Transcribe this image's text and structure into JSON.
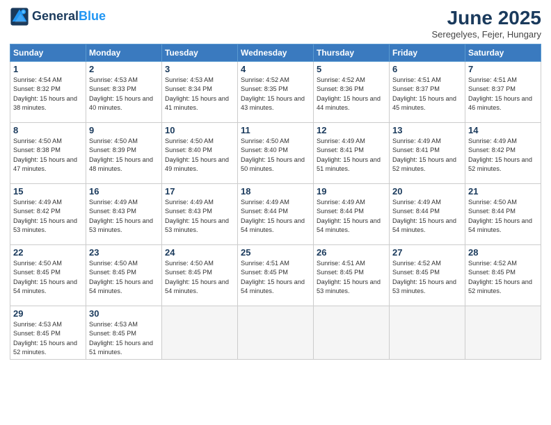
{
  "header": {
    "logo_line1": "General",
    "logo_line2": "Blue",
    "month_year": "June 2025",
    "location": "Seregelyes, Fejer, Hungary"
  },
  "weekdays": [
    "Sunday",
    "Monday",
    "Tuesday",
    "Wednesday",
    "Thursday",
    "Friday",
    "Saturday"
  ],
  "weeks": [
    [
      {
        "day": 1,
        "sunrise": "4:54 AM",
        "sunset": "8:32 PM",
        "daylight": "15 hours and 38 minutes."
      },
      {
        "day": 2,
        "sunrise": "4:53 AM",
        "sunset": "8:33 PM",
        "daylight": "15 hours and 40 minutes."
      },
      {
        "day": 3,
        "sunrise": "4:53 AM",
        "sunset": "8:34 PM",
        "daylight": "15 hours and 41 minutes."
      },
      {
        "day": 4,
        "sunrise": "4:52 AM",
        "sunset": "8:35 PM",
        "daylight": "15 hours and 43 minutes."
      },
      {
        "day": 5,
        "sunrise": "4:52 AM",
        "sunset": "8:36 PM",
        "daylight": "15 hours and 44 minutes."
      },
      {
        "day": 6,
        "sunrise": "4:51 AM",
        "sunset": "8:37 PM",
        "daylight": "15 hours and 45 minutes."
      },
      {
        "day": 7,
        "sunrise": "4:51 AM",
        "sunset": "8:37 PM",
        "daylight": "15 hours and 46 minutes."
      }
    ],
    [
      {
        "day": 8,
        "sunrise": "4:50 AM",
        "sunset": "8:38 PM",
        "daylight": "15 hours and 47 minutes."
      },
      {
        "day": 9,
        "sunrise": "4:50 AM",
        "sunset": "8:39 PM",
        "daylight": "15 hours and 48 minutes."
      },
      {
        "day": 10,
        "sunrise": "4:50 AM",
        "sunset": "8:40 PM",
        "daylight": "15 hours and 49 minutes."
      },
      {
        "day": 11,
        "sunrise": "4:50 AM",
        "sunset": "8:40 PM",
        "daylight": "15 hours and 50 minutes."
      },
      {
        "day": 12,
        "sunrise": "4:49 AM",
        "sunset": "8:41 PM",
        "daylight": "15 hours and 51 minutes."
      },
      {
        "day": 13,
        "sunrise": "4:49 AM",
        "sunset": "8:41 PM",
        "daylight": "15 hours and 52 minutes."
      },
      {
        "day": 14,
        "sunrise": "4:49 AM",
        "sunset": "8:42 PM",
        "daylight": "15 hours and 52 minutes."
      }
    ],
    [
      {
        "day": 15,
        "sunrise": "4:49 AM",
        "sunset": "8:42 PM",
        "daylight": "15 hours and 53 minutes."
      },
      {
        "day": 16,
        "sunrise": "4:49 AM",
        "sunset": "8:43 PM",
        "daylight": "15 hours and 53 minutes."
      },
      {
        "day": 17,
        "sunrise": "4:49 AM",
        "sunset": "8:43 PM",
        "daylight": "15 hours and 53 minutes."
      },
      {
        "day": 18,
        "sunrise": "4:49 AM",
        "sunset": "8:44 PM",
        "daylight": "15 hours and 54 minutes."
      },
      {
        "day": 19,
        "sunrise": "4:49 AM",
        "sunset": "8:44 PM",
        "daylight": "15 hours and 54 minutes."
      },
      {
        "day": 20,
        "sunrise": "4:49 AM",
        "sunset": "8:44 PM",
        "daylight": "15 hours and 54 minutes."
      },
      {
        "day": 21,
        "sunrise": "4:50 AM",
        "sunset": "8:44 PM",
        "daylight": "15 hours and 54 minutes."
      }
    ],
    [
      {
        "day": 22,
        "sunrise": "4:50 AM",
        "sunset": "8:45 PM",
        "daylight": "15 hours and 54 minutes."
      },
      {
        "day": 23,
        "sunrise": "4:50 AM",
        "sunset": "8:45 PM",
        "daylight": "15 hours and 54 minutes."
      },
      {
        "day": 24,
        "sunrise": "4:50 AM",
        "sunset": "8:45 PM",
        "daylight": "15 hours and 54 minutes."
      },
      {
        "day": 25,
        "sunrise": "4:51 AM",
        "sunset": "8:45 PM",
        "daylight": "15 hours and 54 minutes."
      },
      {
        "day": 26,
        "sunrise": "4:51 AM",
        "sunset": "8:45 PM",
        "daylight": "15 hours and 53 minutes."
      },
      {
        "day": 27,
        "sunrise": "4:52 AM",
        "sunset": "8:45 PM",
        "daylight": "15 hours and 53 minutes."
      },
      {
        "day": 28,
        "sunrise": "4:52 AM",
        "sunset": "8:45 PM",
        "daylight": "15 hours and 52 minutes."
      }
    ],
    [
      {
        "day": 29,
        "sunrise": "4:53 AM",
        "sunset": "8:45 PM",
        "daylight": "15 hours and 52 minutes."
      },
      {
        "day": 30,
        "sunrise": "4:53 AM",
        "sunset": "8:45 PM",
        "daylight": "15 hours and 51 minutes."
      },
      null,
      null,
      null,
      null,
      null
    ]
  ]
}
